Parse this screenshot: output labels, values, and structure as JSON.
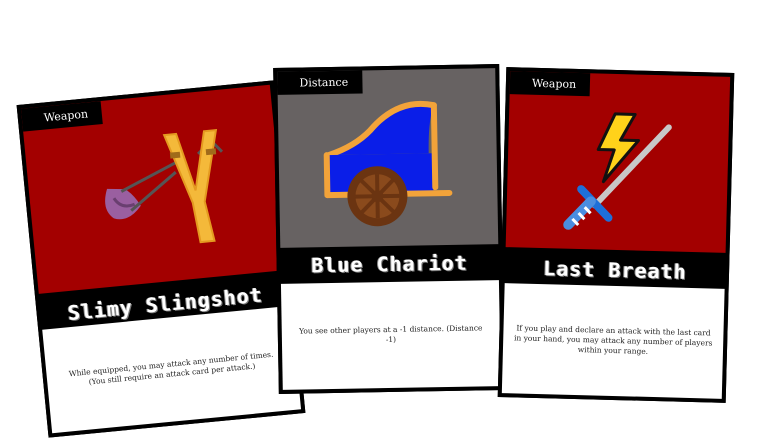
{
  "cards": [
    {
      "type": "Weapon",
      "name": "Slimy Slingshot",
      "text_line1": "While equipped, you may attack any number of times.",
      "text_line2": "(You still require an attack card per attack.)",
      "art_color": "#a30000",
      "art_icon": "slingshot-icon"
    },
    {
      "type": "Distance",
      "name": "Blue Chariot",
      "text_line1": "You see other players at a -1 distance. (Distance -1)",
      "text_line2": "",
      "art_color": "#676262",
      "art_icon": "chariot-icon"
    },
    {
      "type": "Weapon",
      "name": "Last Breath",
      "text_line1": "If you play and declare an attack with the last card in your hand, you may attack any number of players within your range.",
      "text_line2": "",
      "art_color": "#a30000",
      "art_icon": "lightning-sword-icon"
    }
  ]
}
